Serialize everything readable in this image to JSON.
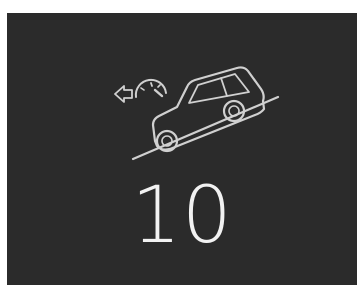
{
  "display": {
    "icon": "hill-descent-control-icon",
    "setpoint_value": "10",
    "background_color": "#2b2b2b",
    "foreground_color": "#d9d9d9"
  }
}
